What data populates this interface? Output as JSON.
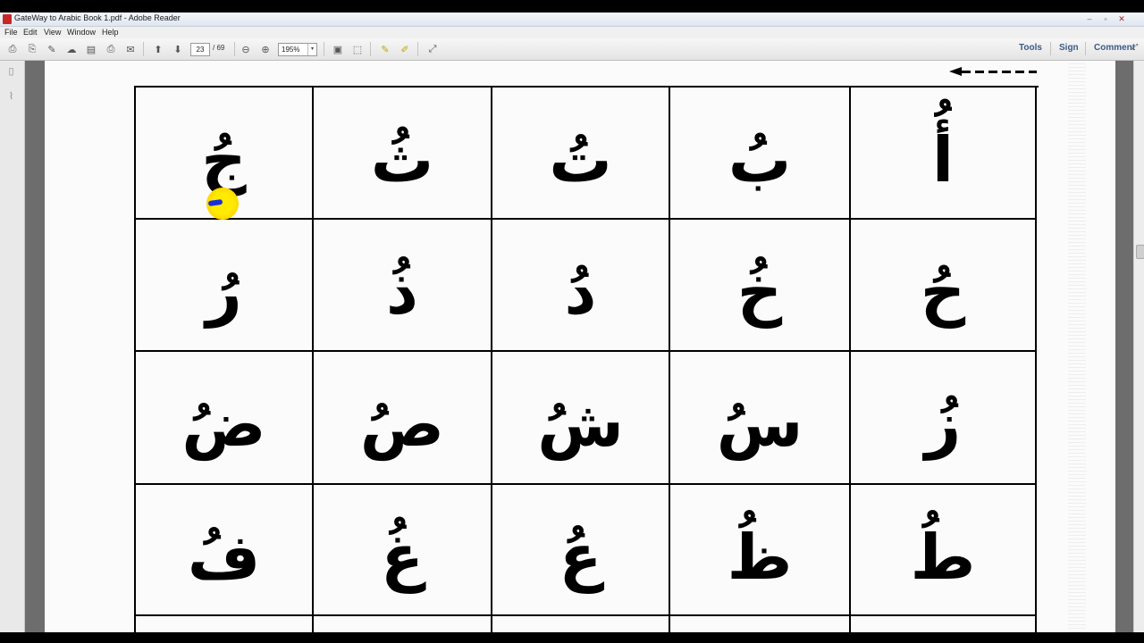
{
  "window": {
    "title": "GateWay to Arabic Book 1.pdf - Adobe Reader",
    "controls": {
      "minimize": "‒",
      "maximize": "▫",
      "close": "✕"
    }
  },
  "menu": [
    "File",
    "Edit",
    "View",
    "Window",
    "Help"
  ],
  "toolbar": {
    "current_page": "23",
    "total_pages": "/ 69",
    "zoom": "195%",
    "zoom_dropdown_icon": "▾",
    "right_links": {
      "tools": "Tools",
      "sign": "Sign",
      "comment": "Comment"
    },
    "icons": [
      "create-pdf-icon",
      "create-pdf-alt-icon",
      "edit-icon",
      "cloud-upload-icon",
      "save-icon",
      "print-icon",
      "email-icon",
      "previous-page-icon",
      "next-page-icon",
      "zoom-out-icon",
      "zoom-in-icon",
      "fit-page-icon",
      "fit-width-icon",
      "comment-icon",
      "highlight-icon",
      "read-mode-icon"
    ]
  },
  "left_panel": {
    "icons": [
      "pages-thumbnail-icon",
      "attachments-icon"
    ]
  },
  "document": {
    "arrow_direction": "right-to-left",
    "letters": [
      [
        "جُ",
        "ثُ",
        "تُ",
        "بُ",
        "أُ"
      ],
      [
        "رُ",
        "ذُ",
        "دُ",
        "خُ",
        "حُ"
      ],
      [
        "ضُ",
        "صُ",
        "شُ",
        "سُ",
        "زُ"
      ],
      [
        "فُ",
        "غُ",
        "عُ",
        "ظُ",
        "طُ"
      ]
    ]
  },
  "colors": {
    "accent_link": "#3c5a86",
    "cursor_highlight": "#ffe600"
  }
}
